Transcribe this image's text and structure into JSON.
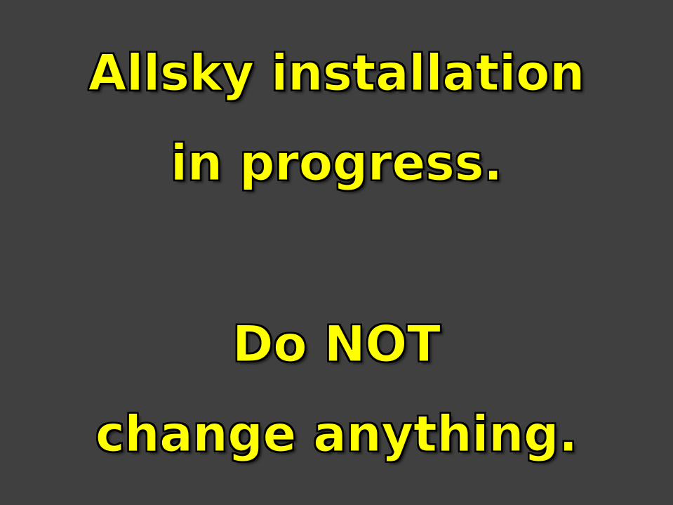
{
  "notice": {
    "lines": [
      "Allsky installation",
      "in progress.",
      "Do NOT",
      "change anything."
    ],
    "colors": {
      "background": "#404040",
      "text": "#FFFF00",
      "outline": "#000000"
    }
  }
}
